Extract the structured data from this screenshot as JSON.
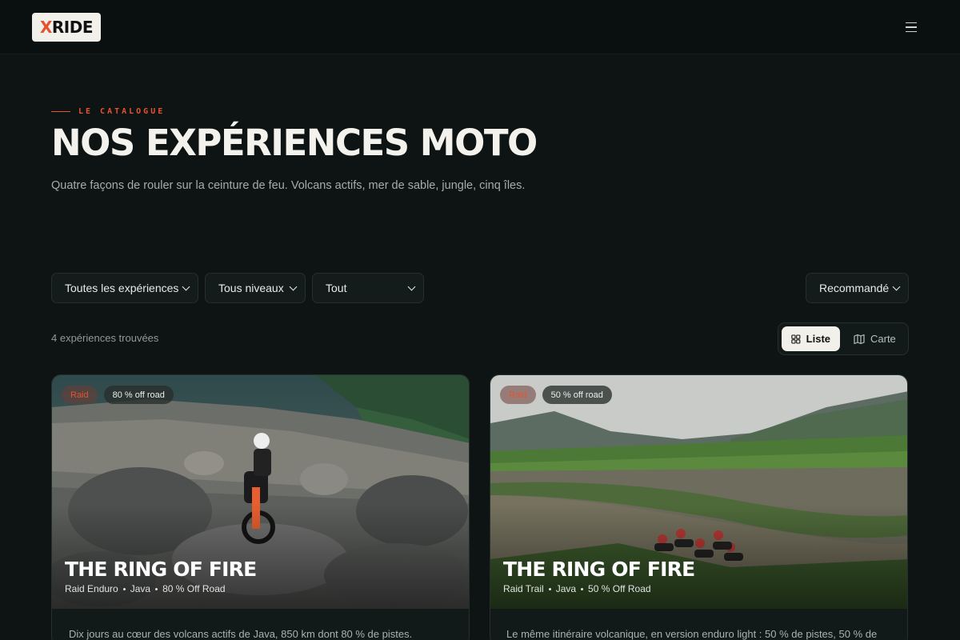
{
  "header": {
    "logo_mark": "X",
    "logo_text": "RIDE",
    "menu_icon": "hamburger-menu-icon"
  },
  "hero": {
    "eyebrow": "LE CATALOGUE",
    "title": "NOS EXPÉRIENCES MOTO",
    "subtitle": "Quatre façons de rouler sur la ceinture de feu. Volcans actifs, mer de sable, jungle, cinq îles."
  },
  "filters": {
    "experience": "Toutes les expériences",
    "level": "Tous niveaux",
    "type": "Tout",
    "sort": "Recommandé"
  },
  "results": {
    "count_text": "4 expériences trouvées"
  },
  "view_toggle": {
    "list_label": "Liste",
    "map_label": "Carte",
    "active": "list",
    "list_icon": "grid-icon",
    "map_icon": "map-icon"
  },
  "cards": [
    {
      "tag": "Raid",
      "offroad": "80 % off road",
      "title": "THE RING OF FIRE",
      "meta": [
        "Raid Enduro",
        "Java",
        "80 % Off Road"
      ],
      "description": "Dix jours au cœur des volcans actifs de Java, 850 km dont 80 % de pistes."
    },
    {
      "tag": "Raid",
      "offroad": "50 % off road",
      "title": "THE RING OF FIRE",
      "meta": [
        "Raid Trail",
        "Java",
        "50 % Off Road"
      ],
      "description": "Le même itinéraire volcanique, en version enduro light : 50 % de pistes, 50 % de"
    }
  ],
  "colors": {
    "background": "#0d1413",
    "accent": "#e5532f",
    "surface": "#131c1b"
  }
}
